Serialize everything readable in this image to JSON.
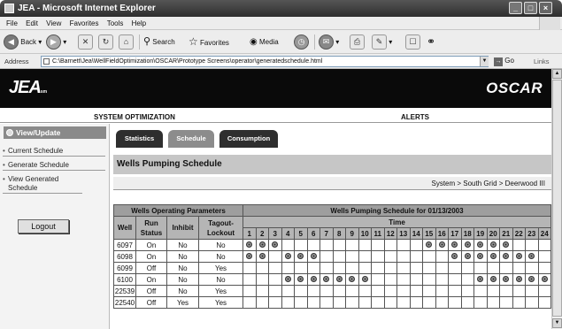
{
  "window": {
    "title": "JEA - Microsoft Internet Explorer"
  },
  "menu": [
    "File",
    "Edit",
    "View",
    "Favorites",
    "Tools",
    "Help"
  ],
  "toolbar": {
    "back": "Back",
    "search": "Search",
    "favorites": "Favorites",
    "media": "Media"
  },
  "address": {
    "label": "Address",
    "url": "C:\\Barnett\\Jea\\WellFieldOptimization\\OSCAR\\Prototype Screens\\operator\\generatedschedule.html",
    "go": "Go",
    "links": "Links"
  },
  "header": {
    "logo": "JEA",
    "logo_sub": "sm",
    "app": "OSCAR"
  },
  "sections": {
    "left": "SYSTEM OPTIMIZATION",
    "right": "ALERTS"
  },
  "sidebar": {
    "heading": "View/Update",
    "items": [
      {
        "label": "Current Schedule"
      },
      {
        "label": "Generate Schedule"
      },
      {
        "label": "View Generated Schedule"
      }
    ],
    "logout": "Logout"
  },
  "tabs": [
    {
      "label": "Statistics",
      "active": false
    },
    {
      "label": "Schedule",
      "active": true
    },
    {
      "label": "Consumption",
      "active": false
    }
  ],
  "main": {
    "title": "Wells Pumping Schedule",
    "breadcrumb": "System > South Grid > Deerwood III"
  },
  "table": {
    "params_header": "Wells Operating Parameters",
    "schedule_header": "Wells Pumping Schedule for 01/13/2003",
    "columns": {
      "well": "Well",
      "run_status": "Run Status",
      "inhibit": "Inhibit",
      "tagout": "Tagout-Lockout"
    },
    "time_label": "Time",
    "hours": [
      "1",
      "2",
      "3",
      "4",
      "5",
      "6",
      "7",
      "8",
      "9",
      "10",
      "11",
      "12",
      "13",
      "14",
      "15",
      "16",
      "17",
      "18",
      "19",
      "20",
      "21",
      "22",
      "23",
      "24"
    ],
    "rows": [
      {
        "well": "6097",
        "status": "On",
        "inhibit": "No",
        "tagout": "No",
        "on_hours": [
          1,
          2,
          3,
          15,
          16,
          17,
          18,
          19,
          20,
          21
        ]
      },
      {
        "well": "6098",
        "status": "On",
        "inhibit": "No",
        "tagout": "No",
        "on_hours": [
          1,
          2,
          4,
          5,
          6,
          17,
          18,
          19,
          20,
          21,
          22,
          23
        ]
      },
      {
        "well": "6099",
        "status": "Off",
        "inhibit": "No",
        "tagout": "Yes",
        "on_hours": []
      },
      {
        "well": "6100",
        "status": "On",
        "inhibit": "No",
        "tagout": "No",
        "on_hours": [
          4,
          5,
          6,
          7,
          8,
          9,
          10,
          19,
          20,
          21,
          22,
          23,
          24
        ]
      },
      {
        "well": "22539",
        "status": "Off",
        "inhibit": "No",
        "tagout": "Yes",
        "on_hours": []
      },
      {
        "well": "22540",
        "status": "Off",
        "inhibit": "Yes",
        "tagout": "Yes",
        "on_hours": []
      }
    ]
  }
}
